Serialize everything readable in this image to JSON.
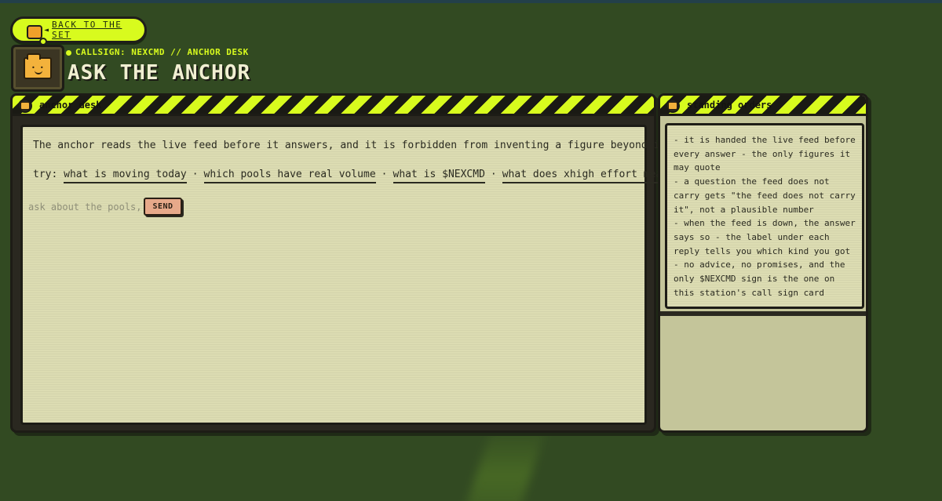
{
  "nav": {
    "back_arrow": "◄",
    "back_label": "BACK TO THE SET"
  },
  "header": {
    "callsign": "CALLSIGN: NEXCMD // ANCHOR DESK",
    "title": "ASK THE ANCHOR"
  },
  "anchor_desk": {
    "label": "anchor desk",
    "intro": "The anchor reads the live feed before it answers, and it is forbidden from inventing a figure beyond it.",
    "try_label": "try:",
    "suggestions": [
      "what is moving today",
      "which pools have real volume",
      "what is $NEXCMD",
      "what does xhigh effort mean"
    ],
    "separator": "·",
    "input_placeholder": "ask about the pools,",
    "send_label": "SEND"
  },
  "standing_orders": {
    "label": "standing orders",
    "items": [
      "- it is handed the live feed before every answer - the only figures it may quote",
      "- a question the feed does not carry gets \"the feed does not carry it\", not a plausible number",
      "- when the feed is down, the answer says so - the label under each reply tells you which kind you got",
      "- no advice, no promises, and the only $NEXCMD sign is the one on this station's call sign card"
    ]
  },
  "colors": {
    "accent": "#d8fb1e",
    "background": "#324a22",
    "screen": "#dcdcb2",
    "send_button": "#e7a98a"
  },
  "icons": [
    "folder-face-icon",
    "back-arrow-icon",
    "panel-badge-icon"
  ]
}
